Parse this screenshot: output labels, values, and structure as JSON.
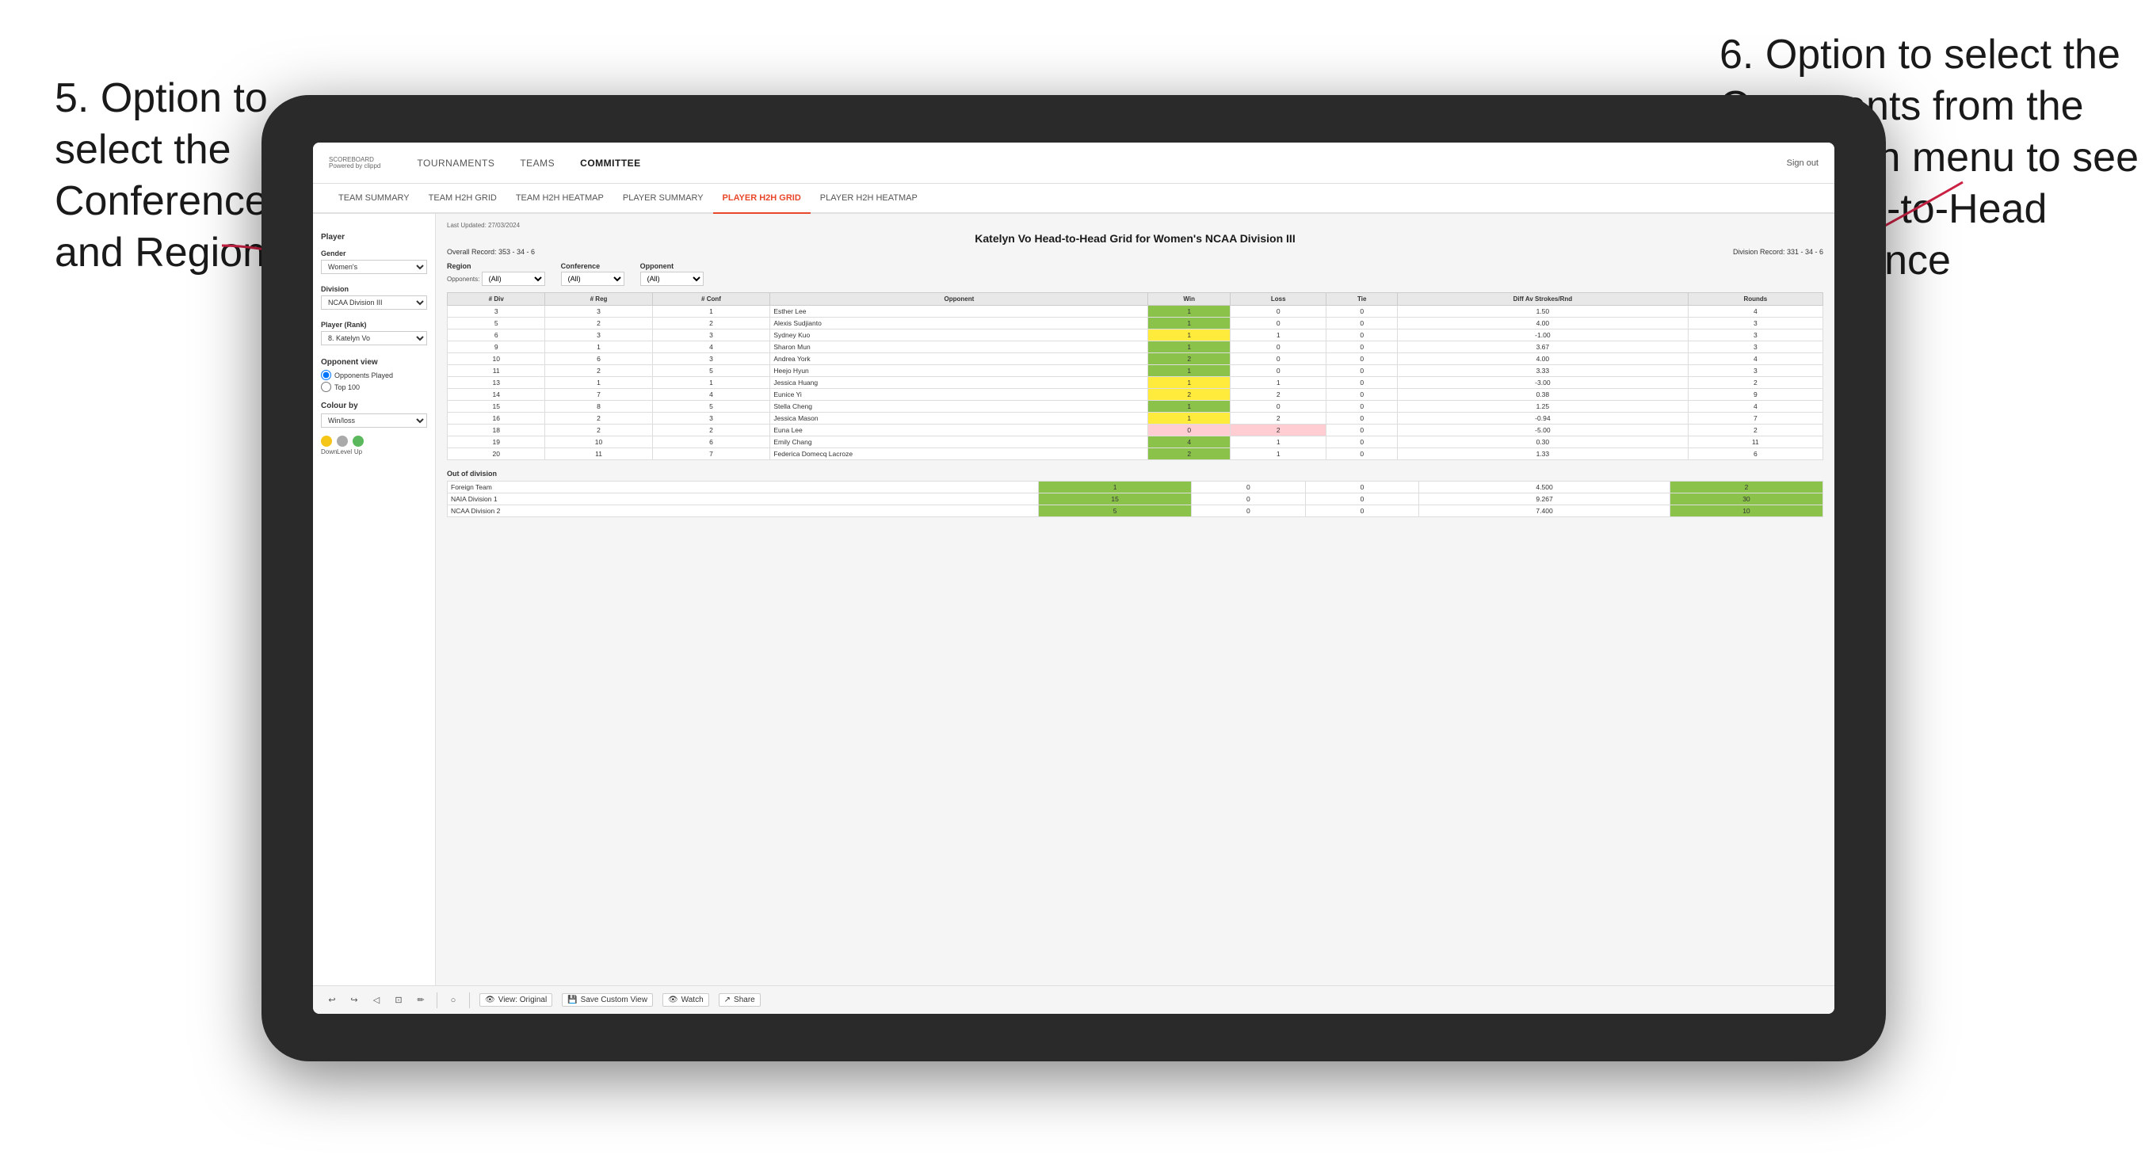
{
  "annotations": {
    "left": {
      "text": "5. Option to select the Conference and Region"
    },
    "right": {
      "text": "6. Option to select the Opponents from the dropdown menu to see the Head-to-Head performance"
    }
  },
  "app": {
    "logo": "SCOREBOARD",
    "logo_sub": "Powered by clippd",
    "sign_out": "Sign out",
    "nav": {
      "items": [
        "TOURNAMENTS",
        "TEAMS",
        "COMMITTEE"
      ]
    },
    "sub_nav": {
      "items": [
        "TEAM SUMMARY",
        "TEAM H2H GRID",
        "TEAM H2H HEATMAP",
        "PLAYER SUMMARY",
        "PLAYER H2H GRID",
        "PLAYER H2H HEATMAP"
      ],
      "active": "PLAYER H2H GRID"
    }
  },
  "sidebar": {
    "player_label": "Player",
    "gender_label": "Gender",
    "gender_value": "Women's",
    "division_label": "Division",
    "division_value": "NCAA Division III",
    "player_rank_label": "Player (Rank)",
    "player_rank_value": "8. Katelyn Vo",
    "opponent_view_label": "Opponent view",
    "opponent_played_label": "Opponents Played",
    "top100_label": "Top 100",
    "colour_by_label": "Colour by",
    "colour_by_value": "Win/loss",
    "down_label": "Down",
    "level_label": "Level",
    "up_label": "Up"
  },
  "report": {
    "last_updated": "Last Updated: 27/03/2024",
    "title": "Katelyn Vo Head-to-Head Grid for Women's NCAA Division III",
    "overall_record": "Overall Record: 353 - 34 - 6",
    "division_record": "Division Record: 331 - 34 - 6",
    "filters": {
      "region_label": "Region",
      "opponents_label": "Opponents:",
      "opponents_value": "(All)",
      "conference_label": "Conference",
      "conference_value": "(All)",
      "opponent_label": "Opponent",
      "opponent_value": "(All)"
    },
    "table_headers": [
      "# Div",
      "# Reg",
      "# Conf",
      "Opponent",
      "Win",
      "Loss",
      "Tie",
      "Diff Av Strokes/Rnd",
      "Rounds"
    ],
    "rows": [
      {
        "div": 3,
        "reg": 3,
        "conf": 1,
        "name": "Esther Lee",
        "win": 1,
        "loss": 0,
        "tie": 0,
        "diff": 1.5,
        "rounds": 4,
        "win_color": "green"
      },
      {
        "div": 5,
        "reg": 2,
        "conf": 2,
        "name": "Alexis Sudjianto",
        "win": 1,
        "loss": 0,
        "tie": 0,
        "diff": 4.0,
        "rounds": 3,
        "win_color": "green"
      },
      {
        "div": 6,
        "reg": 3,
        "conf": 3,
        "name": "Sydney Kuo",
        "win": 1,
        "loss": 1,
        "tie": 0,
        "diff": -1.0,
        "rounds": 3,
        "win_color": "yellow"
      },
      {
        "div": 9,
        "reg": 1,
        "conf": 4,
        "name": "Sharon Mun",
        "win": 1,
        "loss": 0,
        "tie": 0,
        "diff": 3.67,
        "rounds": 3,
        "win_color": "green"
      },
      {
        "div": 10,
        "reg": 6,
        "conf": 3,
        "name": "Andrea York",
        "win": 2,
        "loss": 0,
        "tie": 0,
        "diff": 4.0,
        "rounds": 4,
        "win_color": "green"
      },
      {
        "div": 11,
        "reg": 2,
        "conf": 5,
        "name": "Heejo Hyun",
        "win": 1,
        "loss": 0,
        "tie": 0,
        "diff": 3.33,
        "rounds": 3,
        "win_color": "green"
      },
      {
        "div": 13,
        "reg": 1,
        "conf": 1,
        "name": "Jessica Huang",
        "win": 1,
        "loss": 1,
        "tie": 0,
        "diff": -3.0,
        "rounds": 2,
        "win_color": "yellow"
      },
      {
        "div": 14,
        "reg": 7,
        "conf": 4,
        "name": "Eunice Yi",
        "win": 2,
        "loss": 2,
        "tie": 0,
        "diff": 0.38,
        "rounds": 9,
        "win_color": "yellow"
      },
      {
        "div": 15,
        "reg": 8,
        "conf": 5,
        "name": "Stella Cheng",
        "win": 1,
        "loss": 0,
        "tie": 0,
        "diff": 1.25,
        "rounds": 4,
        "win_color": "green"
      },
      {
        "div": 16,
        "reg": 2,
        "conf": 3,
        "name": "Jessica Mason",
        "win": 1,
        "loss": 2,
        "tie": 0,
        "diff": -0.94,
        "rounds": 7,
        "win_color": "yellow"
      },
      {
        "div": 18,
        "reg": 2,
        "conf": 2,
        "name": "Euna Lee",
        "win": 0,
        "loss": 2,
        "tie": 0,
        "diff": -5.0,
        "rounds": 2,
        "win_color": "red"
      },
      {
        "div": 19,
        "reg": 10,
        "conf": 6,
        "name": "Emily Chang",
        "win": 4,
        "loss": 1,
        "tie": 0,
        "diff": 0.3,
        "rounds": 11,
        "win_color": "green"
      },
      {
        "div": 20,
        "reg": 11,
        "conf": 7,
        "name": "Federica Domecq Lacroze",
        "win": 2,
        "loss": 1,
        "tie": 0,
        "diff": 1.33,
        "rounds": 6,
        "win_color": "green"
      }
    ],
    "out_of_division_label": "Out of division",
    "out_of_division_rows": [
      {
        "name": "Foreign Team",
        "win": 1,
        "loss": 0,
        "tie": 0,
        "diff": 4.5,
        "rounds": 2
      },
      {
        "name": "NAIA Division 1",
        "win": 15,
        "loss": 0,
        "tie": 0,
        "diff": 9.267,
        "rounds": 30
      },
      {
        "name": "NCAA Division 2",
        "win": 5,
        "loss": 0,
        "tie": 0,
        "diff": 7.4,
        "rounds": 10
      }
    ]
  },
  "toolbar": {
    "view_original": "View: Original",
    "save_custom_view": "Save Custom View",
    "watch": "Watch",
    "share": "Share"
  }
}
